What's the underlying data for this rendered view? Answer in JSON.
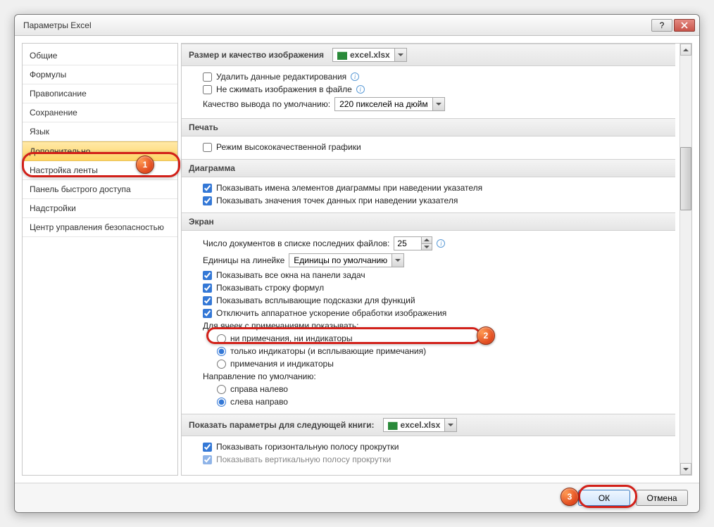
{
  "title": "Параметры Excel",
  "sidebar": {
    "items": [
      {
        "label": "Общие"
      },
      {
        "label": "Формулы"
      },
      {
        "label": "Правописание"
      },
      {
        "label": "Сохранение"
      },
      {
        "label": "Язык"
      },
      {
        "label": "Дополнительно",
        "selected": true
      },
      {
        "label": "Настройка ленты"
      },
      {
        "label": "Панель быстрого доступа"
      },
      {
        "label": "Надстройки"
      },
      {
        "label": "Центр управления безопасностью"
      }
    ]
  },
  "section_img": {
    "header": "Размер и качество изображения",
    "file": "excel.xlsx",
    "delete_edit_data": "Удалить данные редактирования",
    "no_compress": "Не сжимать изображения в файле",
    "default_quality_label": "Качество вывода по умолчанию:",
    "default_quality_value": "220 пикселей на дюйм"
  },
  "section_print": {
    "header": "Печать",
    "hq_graphics": "Режим высококачественной графики"
  },
  "section_chart": {
    "header": "Диаграмма",
    "show_names": "Показывать имена элементов диаграммы при наведении указателя",
    "show_values": "Показывать значения точек данных при наведении указателя"
  },
  "section_screen": {
    "header": "Экран",
    "recent_label": "Число документов в списке последних файлов:",
    "recent_value": "25",
    "ruler_units_label": "Единицы на линейке",
    "ruler_units_value": "Единицы по умолчанию",
    "show_all_windows": "Показывать все окна на панели задач",
    "show_formula_bar": "Показывать строку формул",
    "show_fn_tooltips": "Показывать всплывающие подсказки для функций",
    "disable_hw_accel": "Отключить аппаратное ускорение обработки изображения",
    "comments_label": "Для ячеек с примечаниями показывать:",
    "comments_r1": "ни примечания, ни индикаторы",
    "comments_r2": "только индикаторы (и всплывающие примечания)",
    "comments_r3": "примечания и индикаторы",
    "direction_label": "Направление по умолчанию:",
    "direction_r1": "справа налево",
    "direction_r2": "слева направо"
  },
  "section_book": {
    "header": "Показать параметры для следующей книги:",
    "file": "excel.xlsx",
    "hscroll": "Показывать горизонтальную полосу прокрутки",
    "vscroll": "Показывать вертикальную полосу прокрутки"
  },
  "footer": {
    "ok": "ОК",
    "cancel": "Отмена"
  },
  "callouts": {
    "b1": "1",
    "b2": "2",
    "b3": "3"
  }
}
